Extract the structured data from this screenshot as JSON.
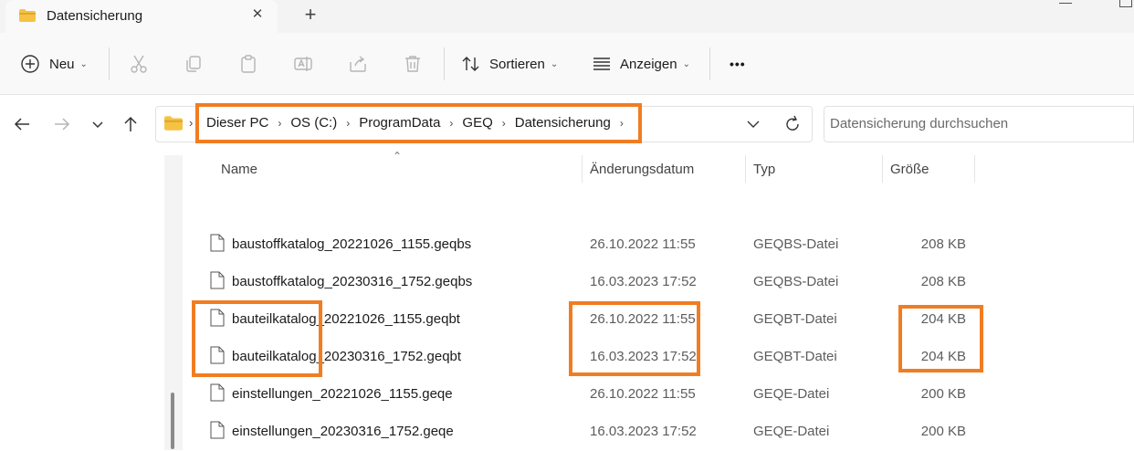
{
  "window": {
    "tab_title": "Datensicherung",
    "tab_close_glyph": "✕",
    "new_tab_glyph": "+",
    "minimize_glyph": "—"
  },
  "toolbar": {
    "new_label": "Neu",
    "sort_label": "Sortieren",
    "view_label": "Anzeigen",
    "more_glyph": "•••",
    "caret_glyph": "⌄",
    "icons": [
      "add-icon",
      "cut-icon",
      "copy-icon",
      "paste-icon",
      "rename-icon",
      "share-icon",
      "delete-icon",
      "sort-icon",
      "view-icon",
      "more-icon"
    ]
  },
  "address": {
    "breadcrumb": [
      "Dieser PC",
      "OS (C:)",
      "ProgramData",
      "GEQ",
      "Datensicherung"
    ],
    "sep_glyph": "›",
    "search_placeholder": "Datensicherung durchsuchen"
  },
  "columns": {
    "name": "Name",
    "date": "Änderungsdatum",
    "type": "Typ",
    "size": "Größe",
    "sort_caret": "⌃"
  },
  "files": [
    {
      "name": "baustoffkatalog_20221026_1155.geqbs",
      "date": "26.10.2022 11:55",
      "type": "GEQBS-Datei",
      "size": "208 KB"
    },
    {
      "name": "baustoffkatalog_20230316_1752.geqbs",
      "date": "16.03.2023 17:52",
      "type": "GEQBS-Datei",
      "size": "208 KB"
    },
    {
      "name": "bauteilkatalog_20221026_1155.geqbt",
      "date": "26.10.2022 11:55",
      "type": "GEQBT-Datei",
      "size": "204 KB"
    },
    {
      "name": "bauteilkatalog_20230316_1752.geqbt",
      "date": "16.03.2023 17:52",
      "type": "GEQBT-Datei",
      "size": "204 KB"
    },
    {
      "name": "einstellungen_20221026_1155.geqe",
      "date": "26.10.2022 11:55",
      "type": "GEQE-Datei",
      "size": "200 KB"
    },
    {
      "name": "einstellungen_20230316_1752.geqe",
      "date": "16.03.2023 17:52",
      "type": "GEQE-Datei",
      "size": "200 KB"
    }
  ],
  "colors": {
    "highlight": "#f07d22",
    "folder": "#f6c244",
    "accent": "#005fb8"
  }
}
